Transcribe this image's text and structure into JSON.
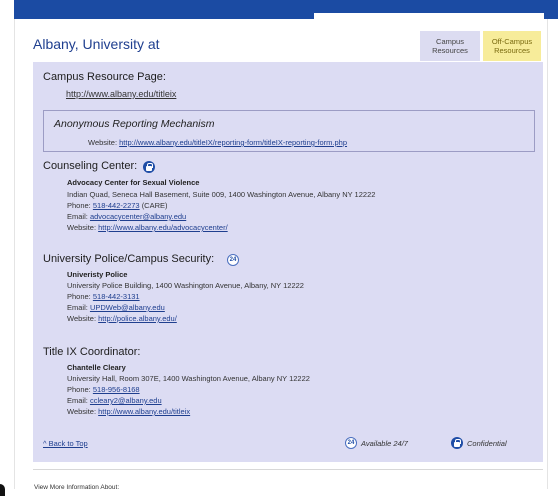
{
  "header": {
    "school_title": "Albany, University at",
    "tabs": [
      {
        "label_line1": "Campus",
        "label_line2": "Resources"
      },
      {
        "label_line1": "Off-Campus",
        "label_line2": "Resources"
      }
    ]
  },
  "campus_resource": {
    "heading": "Campus Resource Page:",
    "url": "http://www.albany.edu/titleix"
  },
  "anonymous": {
    "title": "Anonymous Reporting Mechanism",
    "website_label": "Website:",
    "website_url": "http://www.albany.edu/titleIX/reporting-form/titleIX-reporting-form.php"
  },
  "counseling": {
    "heading": "Counseling Center:",
    "name": "Advocacy Center for Sexual Violence",
    "address": "Indian Quad, Seneca Hall Basement, Suite 009, 1400 Washington Avenue, Albany NY 12222",
    "phone_label": "Phone:",
    "phone": "518-442-2273",
    "phone_note": "(CARE)",
    "email_label": "Email:",
    "email": "advocacycenter@albany.edu",
    "website_label": "Website:",
    "website": "http://www.albany.edu/advocacycenter/"
  },
  "police": {
    "heading": "University Police/Campus Security:",
    "badge": "24",
    "name": "Univeristy Police",
    "address": "University Police Building, 1400 Washington Avenue, Albany, NY 12222",
    "phone_label": "Phone:",
    "phone": "518-442-3131",
    "email_label": "Email:",
    "email": "UPDWeb@albany.edu",
    "website_label": "Website:",
    "website": "http://police.albany.edu/"
  },
  "title_ix": {
    "heading": "Title IX Coordinator:",
    "name": "Chantelle Cleary",
    "address": "University Hall, Room 307E, 1400 Washington Avenue, Albany NY 12222",
    "phone_label": "Phone:",
    "phone": "518-956-8168",
    "email_label": "Email:",
    "email": "ccleary2@albany.edu",
    "website_label": "Website:",
    "website": "http://www.albany.edu/titleix"
  },
  "footer": {
    "back_to_top": "^ Back to Top",
    "legend_available": "Available 24/7",
    "legend_available_badge": "24",
    "legend_confidential": "Confidential",
    "view_more": "View More Information About:"
  },
  "colors": {
    "brand_blue": "#1b4ba3",
    "panel_lavender": "#dcdcf3",
    "offcampus_yellow": "#f7ec9a"
  },
  "icons": [
    "lock-icon",
    "clock-24-icon"
  ]
}
